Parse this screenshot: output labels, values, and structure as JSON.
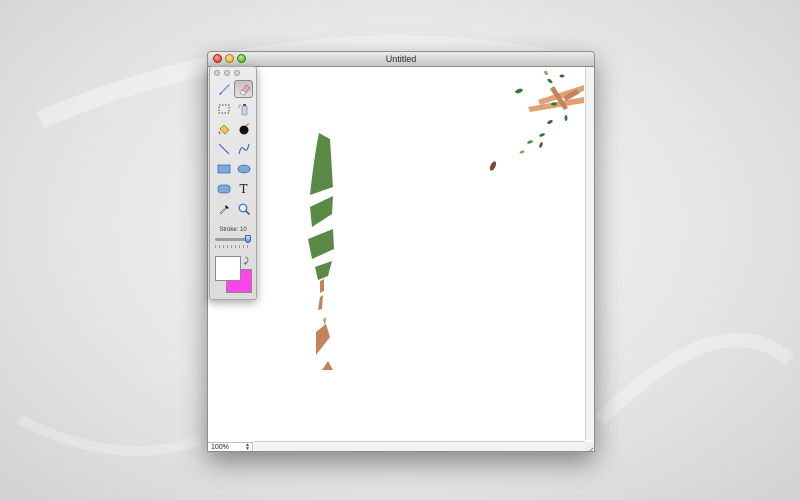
{
  "window": {
    "title": "Untitled",
    "zoom": "100%"
  },
  "palette": {
    "tools": [
      {
        "name": "brush-tool",
        "icon": "brush-icon",
        "selected": false
      },
      {
        "name": "eraser-tool",
        "icon": "eraser-icon",
        "selected": true
      },
      {
        "name": "marquee-select-tool",
        "icon": "marquee-icon",
        "selected": false
      },
      {
        "name": "spray-can-tool",
        "icon": "spray-can-icon",
        "selected": false
      },
      {
        "name": "paint-bucket-tool",
        "icon": "paint-bucket-icon",
        "selected": false
      },
      {
        "name": "bomb-tool",
        "icon": "bomb-icon",
        "selected": false
      },
      {
        "name": "line-tool",
        "icon": "line-icon",
        "selected": false
      },
      {
        "name": "curve-tool",
        "icon": "curve-icon",
        "selected": false
      },
      {
        "name": "rectangle-tool",
        "icon": "rectangle-icon",
        "selected": false
      },
      {
        "name": "ellipse-tool",
        "icon": "ellipse-icon",
        "selected": false
      },
      {
        "name": "rounded-rectangle-tool",
        "icon": "rounded-rectangle-icon",
        "selected": false
      },
      {
        "name": "text-tool",
        "icon": "text-icon",
        "selected": false
      },
      {
        "name": "eyedropper-tool",
        "icon": "eyedropper-icon",
        "selected": false
      },
      {
        "name": "zoom-tool",
        "icon": "magnifier-icon",
        "selected": false
      }
    ],
    "stroke_label": "Stroke: 10",
    "stroke_value": 10,
    "text_tool_glyph": "T",
    "swap_glyph": "⤸",
    "foreground_color": "#ffffff",
    "background_color": "#ff44ee"
  },
  "colors": {
    "leaf_green": "#5a8a45",
    "trunk_brown": "#c4845a",
    "branch_tan": "#e0a272",
    "dark_leaf": "#7a4a2c"
  }
}
